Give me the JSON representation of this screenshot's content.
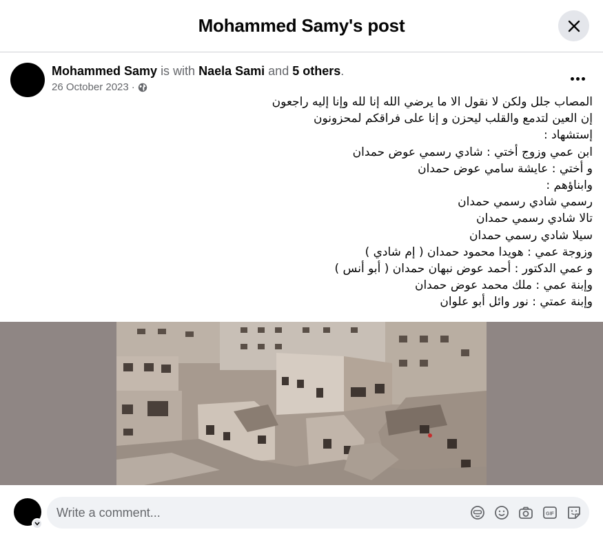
{
  "header": {
    "title": "Mohammed Samy's post"
  },
  "post": {
    "author": "Mohammed Samy",
    "with_text": "is with",
    "tagged": "Naela Sami",
    "and_text": "and",
    "others": "5 others",
    "date": "26 October 2023",
    "separator": "·",
    "privacy_icon": "globe-icon",
    "lines": [
      "المصاب جلل ولكن لا نقول الا ما يرضي الله إنا لله وإنا إليه راجعون",
      "إن العين لتدمع والقلب ليحزن و إنا على فراقكم لمحزونون",
      "إستشهاد :",
      "ابن عمي وزوج أختي : شادي رسمي عوض حمدان",
      "و أختي : عايشة سامي عوض حمدان",
      "وابناؤهم :",
      "رسمي شادي رسمي حمدان",
      "تالا شادي رسمي حمدان",
      "سيلا شادي رسمي حمدان",
      "وزوجة عمي : هويدا محمود حمدان ( إم شادي )",
      "و عمي الدكتور : أحمد عوض نبهان حمدان ( أبو أنس )",
      "وإبنة عمي : ملك محمد عوض حمدان",
      "وإبنة عمتي : نور وائل أبو علوان"
    ]
  },
  "comment": {
    "placeholder": "Write a comment...",
    "icons": [
      "avatar-sticker-icon",
      "emoji-icon",
      "camera-icon",
      "gif-icon",
      "sticker-icon"
    ]
  },
  "colors": {
    "text": "#050505",
    "secondary": "#65676b",
    "bar": "#f0f2f5",
    "image_bg": "#8f8684"
  }
}
